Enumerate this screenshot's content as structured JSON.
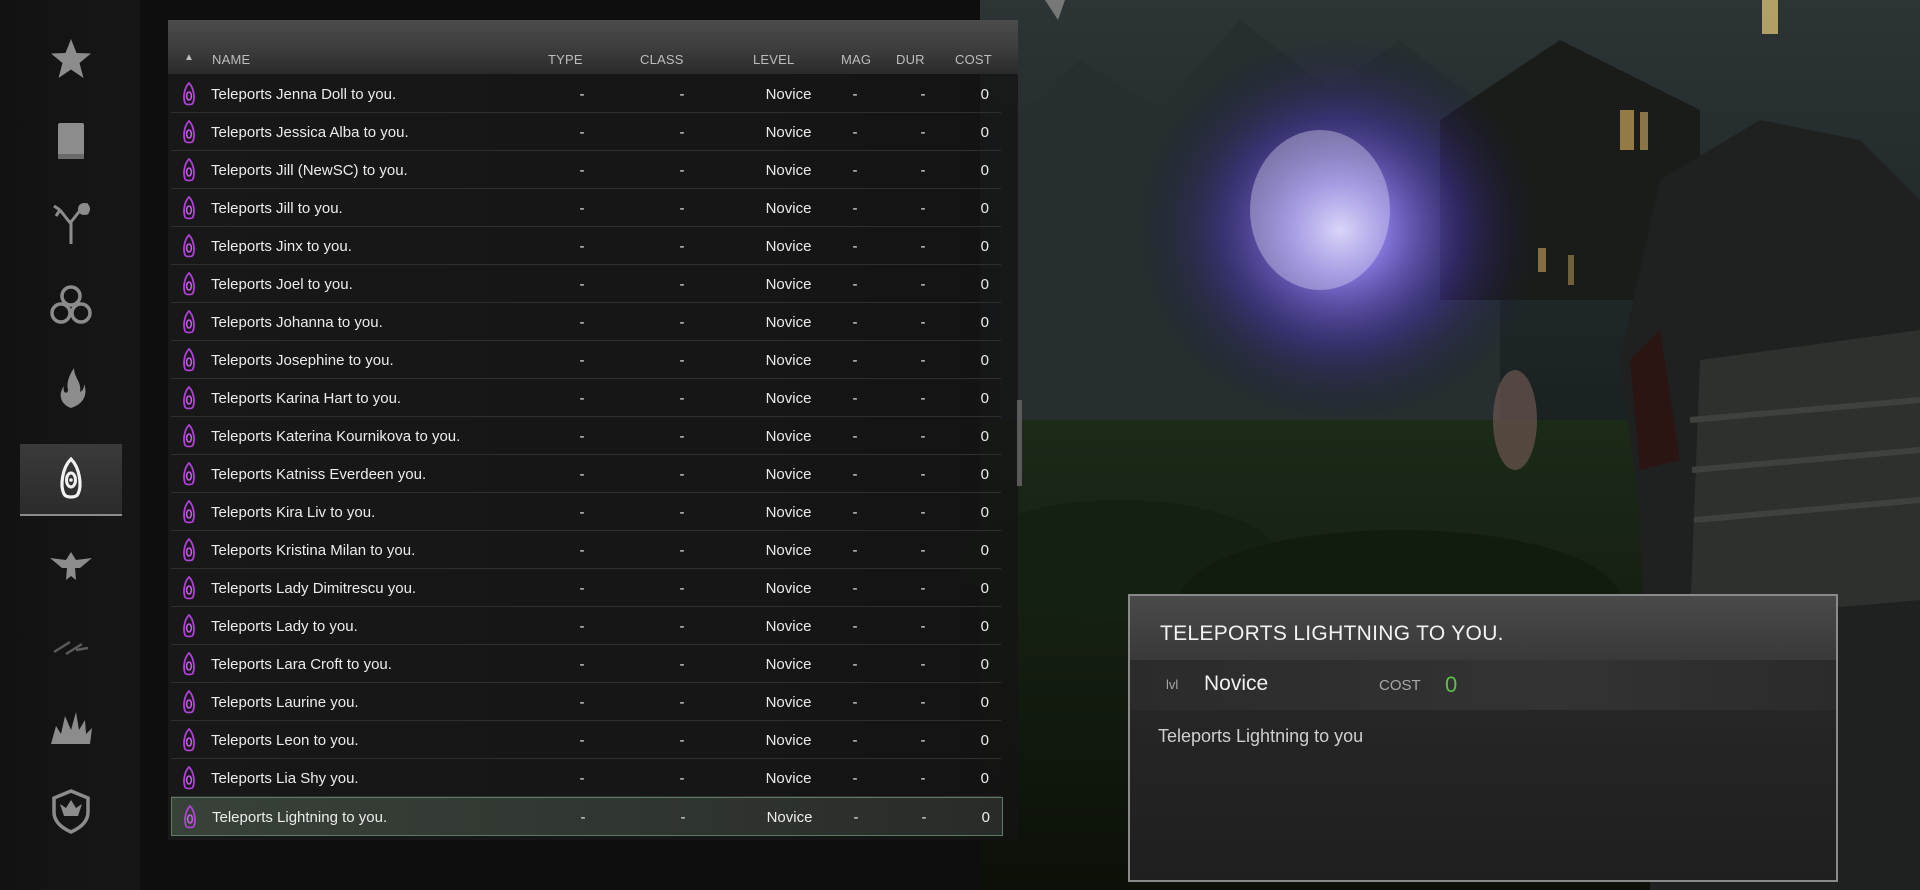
{
  "menu": {
    "categories": [
      {
        "icon": "star-icon",
        "active": false
      },
      {
        "icon": "book-icon",
        "active": false
      },
      {
        "icon": "alteration-tree-icon",
        "active": false
      },
      {
        "icon": "illusion-rings-icon",
        "active": false
      },
      {
        "icon": "destruction-flame-icon",
        "active": false
      },
      {
        "icon": "conjuration-icon",
        "active": true
      },
      {
        "icon": "restoration-eagle-icon",
        "active": false
      },
      {
        "icon": "wind-icon",
        "active": false
      },
      {
        "icon": "burst-icon",
        "active": false
      },
      {
        "icon": "shield-icon",
        "active": false
      }
    ]
  },
  "list": {
    "headers": {
      "name": "NAME",
      "type": "TYPE",
      "class": "CLASS",
      "level": "LEVEL",
      "mag": "MAG",
      "dur": "DUR",
      "cost": "COST"
    },
    "spell_icon": "conjuration-spell-icon",
    "spells": [
      {
        "name": "Teleports Jenna Doll to you.",
        "type": "-",
        "class": "-",
        "level": "Novice",
        "mag": "-",
        "dur": "-",
        "cost": "0"
      },
      {
        "name": "Teleports Jessica Alba to you.",
        "type": "-",
        "class": "-",
        "level": "Novice",
        "mag": "-",
        "dur": "-",
        "cost": "0"
      },
      {
        "name": "Teleports Jill (NewSC) to you.",
        "type": "-",
        "class": "-",
        "level": "Novice",
        "mag": "-",
        "dur": "-",
        "cost": "0"
      },
      {
        "name": "Teleports Jill to you.",
        "type": "-",
        "class": "-",
        "level": "Novice",
        "mag": "-",
        "dur": "-",
        "cost": "0"
      },
      {
        "name": "Teleports Jinx to you.",
        "type": "-",
        "class": "-",
        "level": "Novice",
        "mag": "-",
        "dur": "-",
        "cost": "0"
      },
      {
        "name": "Teleports Joel to you.",
        "type": "-",
        "class": "-",
        "level": "Novice",
        "mag": "-",
        "dur": "-",
        "cost": "0"
      },
      {
        "name": "Teleports Johanna to you.",
        "type": "-",
        "class": "-",
        "level": "Novice",
        "mag": "-",
        "dur": "-",
        "cost": "0"
      },
      {
        "name": "Teleports Josephine to you.",
        "type": "-",
        "class": "-",
        "level": "Novice",
        "mag": "-",
        "dur": "-",
        "cost": "0"
      },
      {
        "name": "Teleports Karina Hart to you.",
        "type": "-",
        "class": "-",
        "level": "Novice",
        "mag": "-",
        "dur": "-",
        "cost": "0"
      },
      {
        "name": "Teleports Katerina Kournikova to you.",
        "type": "-",
        "class": "-",
        "level": "Novice",
        "mag": "-",
        "dur": "-",
        "cost": "0"
      },
      {
        "name": "Teleports Katniss Everdeen you.",
        "type": "-",
        "class": "-",
        "level": "Novice",
        "mag": "-",
        "dur": "-",
        "cost": "0"
      },
      {
        "name": "Teleports Kira Liv to you.",
        "type": "-",
        "class": "-",
        "level": "Novice",
        "mag": "-",
        "dur": "-",
        "cost": "0"
      },
      {
        "name": "Teleports Kristina Milan to you.",
        "type": "-",
        "class": "-",
        "level": "Novice",
        "mag": "-",
        "dur": "-",
        "cost": "0"
      },
      {
        "name": "Teleports Lady Dimitrescu you.",
        "type": "-",
        "class": "-",
        "level": "Novice",
        "mag": "-",
        "dur": "-",
        "cost": "0"
      },
      {
        "name": "Teleports Lady to you.",
        "type": "-",
        "class": "-",
        "level": "Novice",
        "mag": "-",
        "dur": "-",
        "cost": "0"
      },
      {
        "name": "Teleports Lara Croft to you.",
        "type": "-",
        "class": "-",
        "level": "Novice",
        "mag": "-",
        "dur": "-",
        "cost": "0"
      },
      {
        "name": "Teleports Laurine you.",
        "type": "-",
        "class": "-",
        "level": "Novice",
        "mag": "-",
        "dur": "-",
        "cost": "0"
      },
      {
        "name": "Teleports Leon to you.",
        "type": "-",
        "class": "-",
        "level": "Novice",
        "mag": "-",
        "dur": "-",
        "cost": "0"
      },
      {
        "name": "Teleports Lia Shy you.",
        "type": "-",
        "class": "-",
        "level": "Novice",
        "mag": "-",
        "dur": "-",
        "cost": "0"
      },
      {
        "name": "Teleports Lightning to you.",
        "type": "-",
        "class": "-",
        "level": "Novice",
        "mag": "-",
        "dur": "-",
        "cost": "0",
        "selected": true
      }
    ]
  },
  "details": {
    "title": "TELEPORTS LIGHTNING TO YOU.",
    "level_label": "lvl",
    "level_value": "Novice",
    "cost_label": "COST",
    "cost_value": "0",
    "description": "Teleports Lightning to you"
  },
  "colors": {
    "accent_green": "#5fbf4b",
    "spell_icon_purple": "#b041d8",
    "selection_border": "#5e7a62"
  }
}
